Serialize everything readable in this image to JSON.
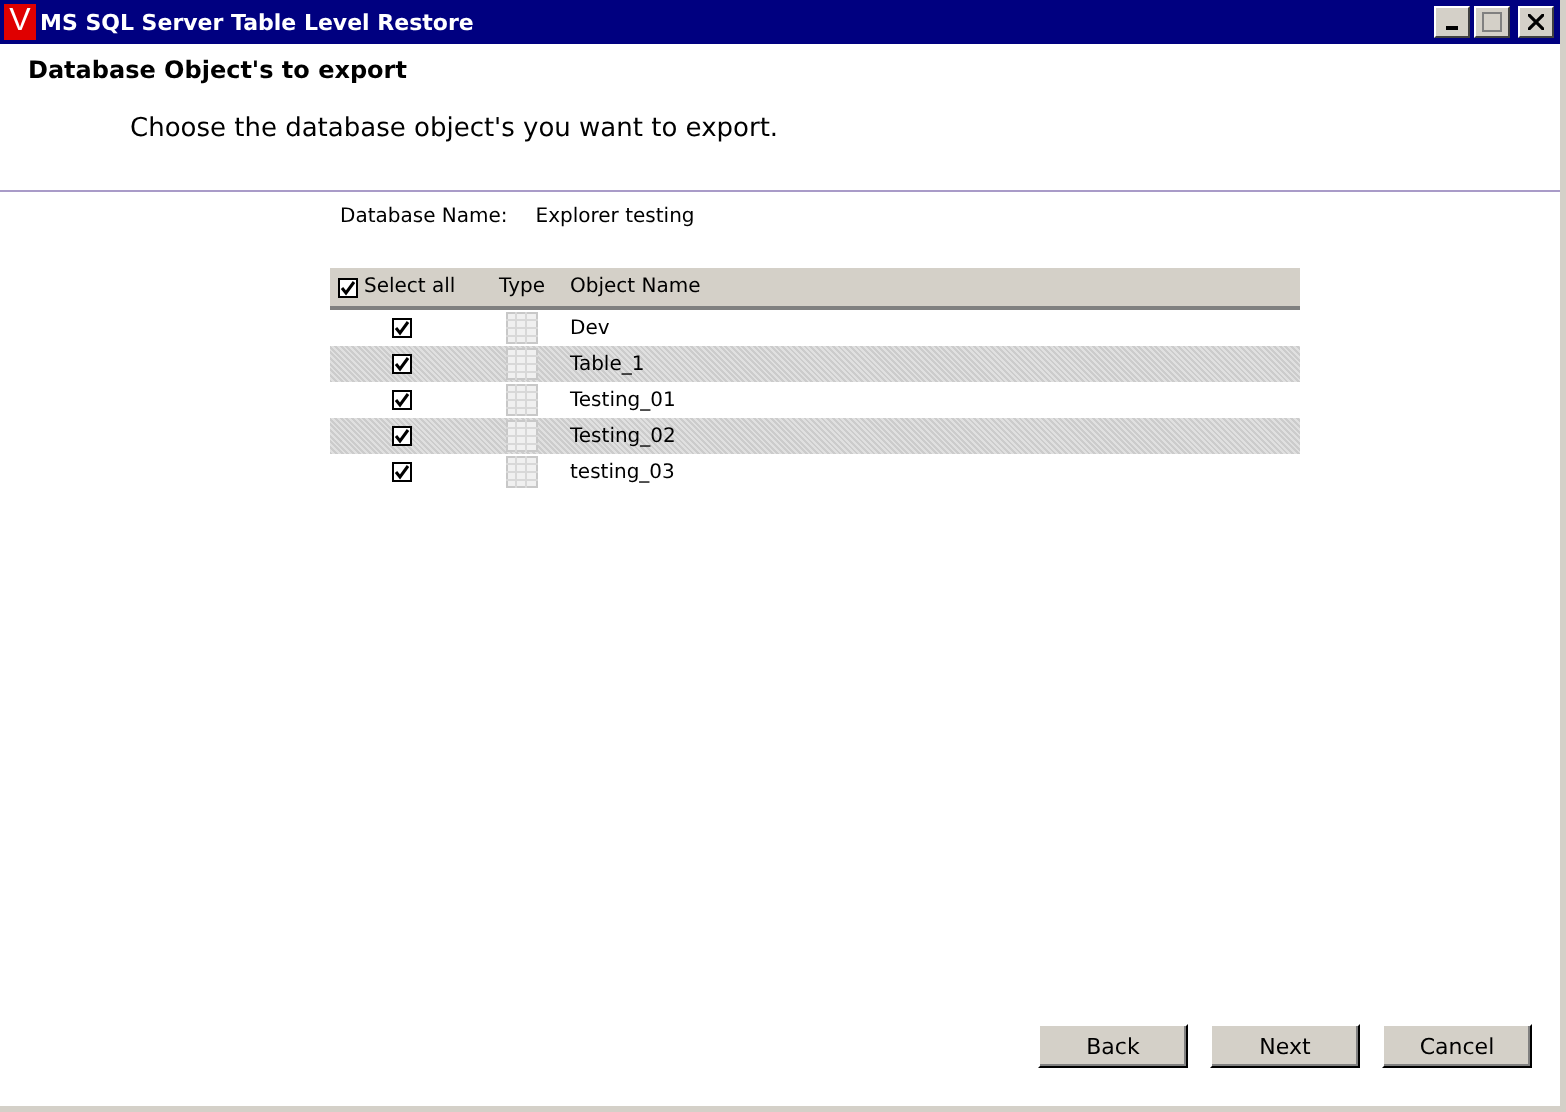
{
  "window": {
    "logo": "V",
    "title": "MS SQL Server Table Level Restore"
  },
  "header": {
    "title": "Database Object's to export",
    "subtitle": "Choose the database object's you want to export."
  },
  "database": {
    "label": "Database Name:",
    "value": "Explorer testing"
  },
  "table": {
    "select_all": {
      "label": "Select all",
      "checked": true
    },
    "columns": [
      "Type",
      "Object Name"
    ],
    "rows": [
      {
        "checked": true,
        "name": "Dev"
      },
      {
        "checked": true,
        "name": "Table_1"
      },
      {
        "checked": true,
        "name": "Testing_01"
      },
      {
        "checked": true,
        "name": "Testing_02"
      },
      {
        "checked": true,
        "name": "testing_03"
      }
    ]
  },
  "buttons": [
    "Back",
    "Next",
    "Cancel"
  ]
}
